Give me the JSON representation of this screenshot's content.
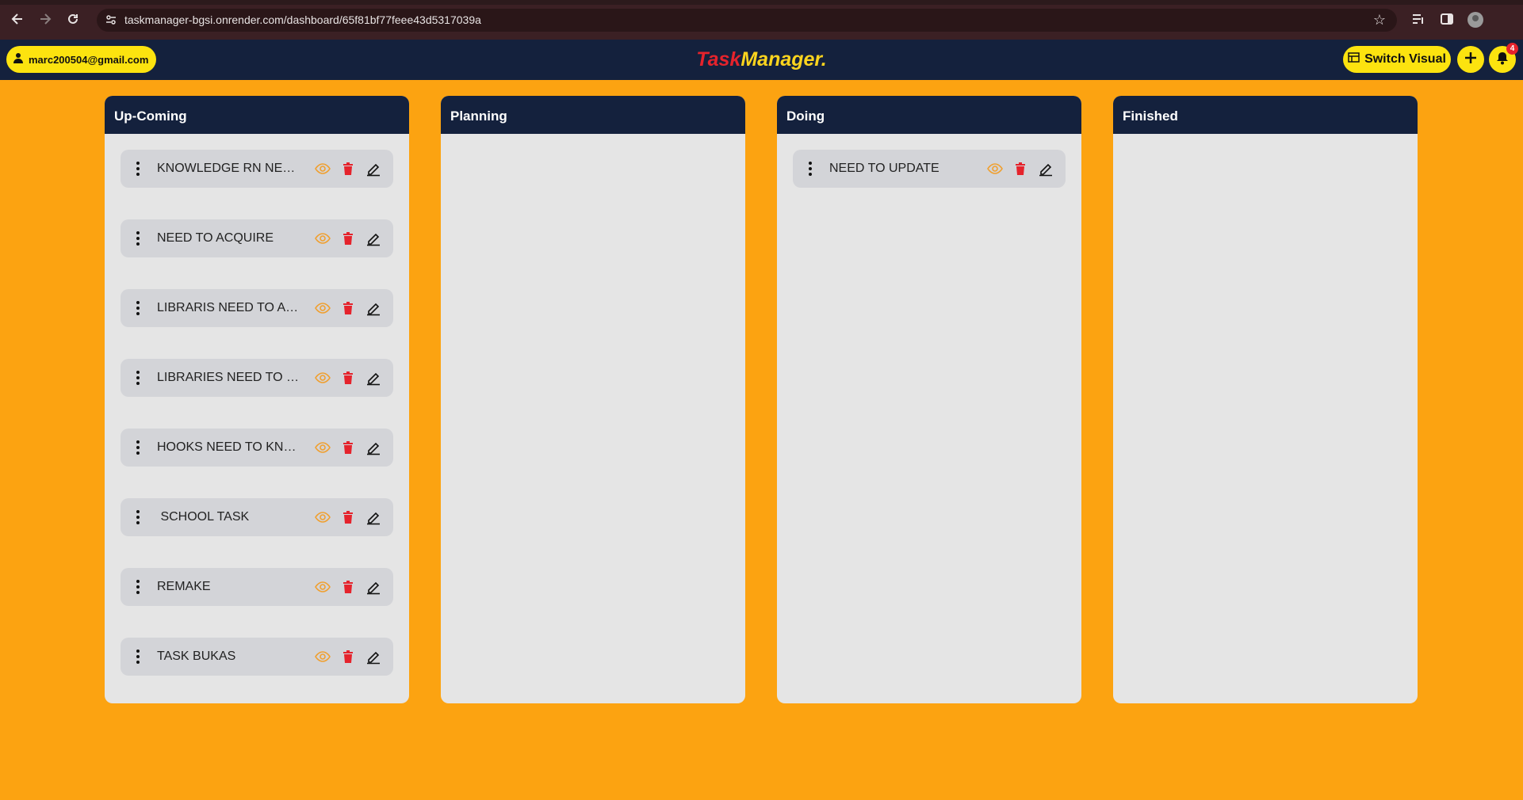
{
  "browser": {
    "url": "taskmanager-bgsi.onrender.com/dashboard/65f81bf77feee43d5317039a",
    "back_icon": "back-arrow-icon",
    "forward_icon": "forward-arrow-icon",
    "reload_icon": "reload-icon"
  },
  "header": {
    "user_email": "marc200504@gmail.com",
    "logo_part1": "Task",
    "logo_part2": "Manager.",
    "switch_label": "Switch Visual",
    "notification_count": "4",
    "colors": {
      "bar": "#14213D",
      "accent": "#FCE30F",
      "logo_red": "#e5232c",
      "logo_yellow": "#FCD41E"
    }
  },
  "board": {
    "background": "#FCA311",
    "columns": [
      {
        "title": "Up-Coming",
        "cards": [
          {
            "title": "KNOWLEDGE RN NEED ..."
          },
          {
            "title": "NEED TO ACQUIRE"
          },
          {
            "title": "LIBRARIS NEED TO ACC..."
          },
          {
            "title": "LIBRARIES NEED TO IM..."
          },
          {
            "title": "HOOKS NEED TO KNOW"
          },
          {
            "title": " SCHOOL TASK"
          },
          {
            "title": "REMAKE"
          },
          {
            "title": "TASK BUKAS"
          }
        ]
      },
      {
        "title": "Planning",
        "cards": []
      },
      {
        "title": "Doing",
        "cards": [
          {
            "title": "NEED TO UPDATE"
          }
        ]
      },
      {
        "title": "Finished",
        "cards": []
      }
    ]
  }
}
